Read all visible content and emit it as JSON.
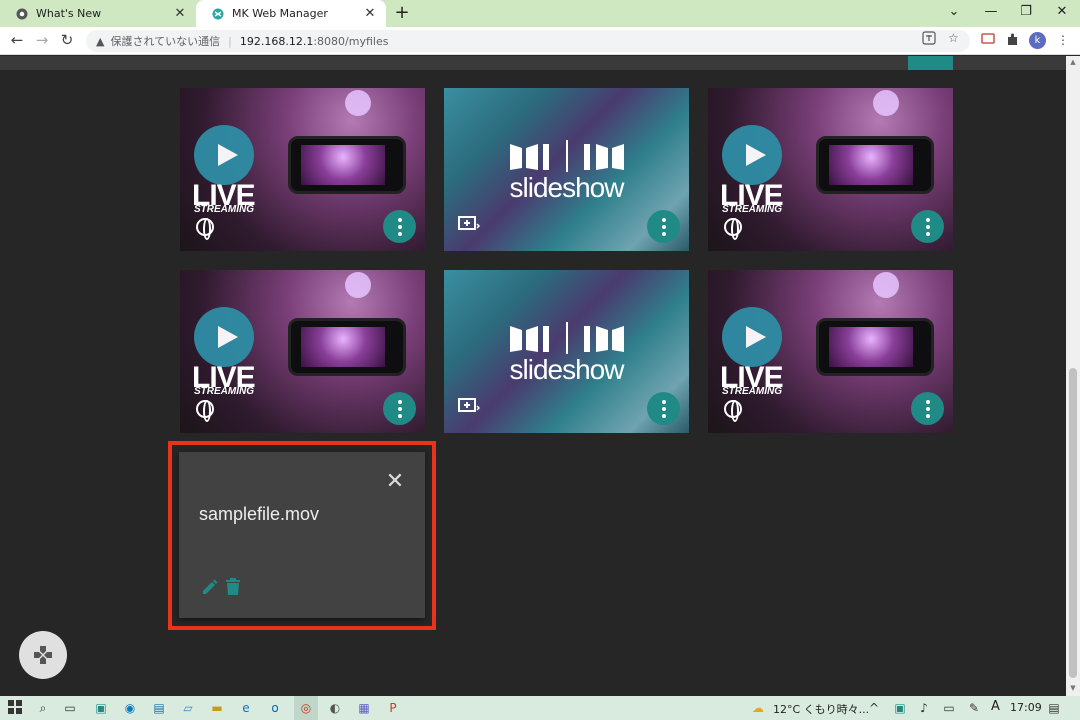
{
  "browser": {
    "tabs": [
      {
        "title": "What's New",
        "active": false
      },
      {
        "title": "MK Web Manager",
        "active": true
      }
    ],
    "new_tab_label": "+",
    "address": {
      "security_text": "保護されていない通信",
      "host": "192.168.12.1",
      "path": ":8080/myfiles"
    },
    "profile_initial": "k",
    "window_controls": {
      "dropdown": "⌄",
      "minimize": "—",
      "restore": "❐",
      "close": "✕"
    }
  },
  "grid": {
    "cards": [
      {
        "type": "live",
        "title": "LIVE",
        "subtitle": "STREAMING"
      },
      {
        "type": "slideshow",
        "title": "slideshow"
      },
      {
        "type": "live",
        "title": "LIVE",
        "subtitle": "STREAMING"
      },
      {
        "type": "live",
        "title": "LIVE",
        "subtitle": "STREAMING"
      },
      {
        "type": "slideshow",
        "title": "slideshow"
      },
      {
        "type": "live",
        "title": "LIVE",
        "subtitle": "STREAMING"
      }
    ]
  },
  "detail_card": {
    "file_name": "samplefile.mov",
    "close_label": "✕"
  },
  "colors": {
    "accent": "#1f8a86",
    "highlight": "#e8341c",
    "page_bg": "#262626",
    "card_bg": "#424242"
  },
  "taskbar": {
    "weather": "12°C くもり時々...",
    "ime": "A",
    "time": "17:09"
  }
}
